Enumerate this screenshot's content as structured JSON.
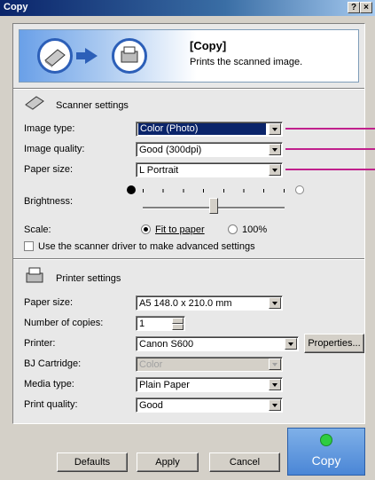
{
  "window": {
    "title": "Copy",
    "help_button": "?",
    "close_button": "×"
  },
  "banner": {
    "title": "[Copy]",
    "description": "Prints the scanned image."
  },
  "scanner": {
    "heading": "Scanner settings",
    "image_type": {
      "label": "Image type:",
      "value": "Color (Photo)"
    },
    "image_quality": {
      "label": "Image quality:",
      "value": "Good (300dpi)"
    },
    "paper_size": {
      "label": "Paper size:",
      "value": "L Portrait"
    },
    "brightness": {
      "label": "Brightness:",
      "level": 0.5
    },
    "scale": {
      "label": "Scale:",
      "fit_label": "Fit to paper",
      "pct_label": "100%",
      "selected": "Fit to paper"
    },
    "driver_checkbox": {
      "label": "Use the scanner driver to make advanced settings",
      "checked": false
    }
  },
  "printer": {
    "heading": "Printer settings",
    "paper_size": {
      "label": "Paper size:",
      "value": "A5 148.0 x 210.0 mm"
    },
    "copies": {
      "label": "Number of copies:",
      "value": "1"
    },
    "printer": {
      "label": "Printer:",
      "value": "Canon S600",
      "properties_label": "Properties..."
    },
    "cartridge": {
      "label": "BJ Cartridge:",
      "value": "Color"
    },
    "media_type": {
      "label": "Media type:",
      "value": "Plain Paper"
    },
    "print_quality": {
      "label": "Print quality:",
      "value": "Good"
    }
  },
  "buttons": {
    "defaults": "Defaults",
    "apply": "Apply",
    "cancel": "Cancel",
    "copy": "Copy"
  },
  "colors": {
    "title_blue": "#0a246a",
    "accent_blue": "#2c5fb8",
    "callout_magenta": "#c0208c",
    "copy_green": "#2ecc40"
  }
}
